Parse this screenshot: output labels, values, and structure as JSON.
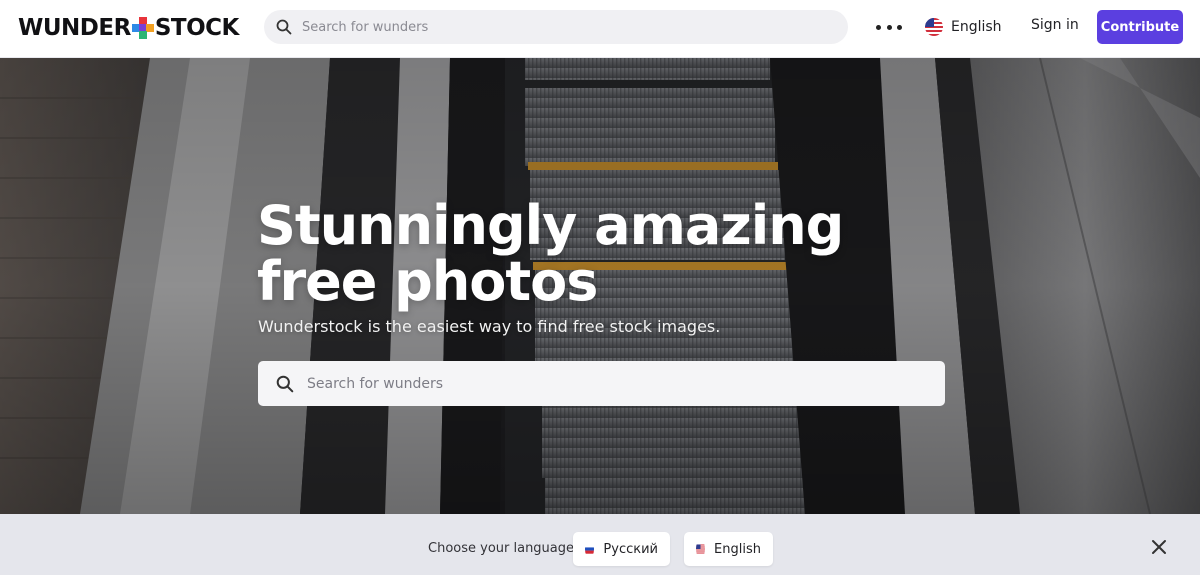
{
  "header": {
    "logo_left": "WUNDER",
    "logo_right": "STOCK",
    "search_placeholder": "Search for wunders",
    "more_icon": "more-horizontal-icon",
    "language_label": "English",
    "signin_label": "Sign in",
    "contribute_label": "Contribute"
  },
  "hero": {
    "title_line1": "Stunningly amazing",
    "title_line2": "free photos",
    "subtitle": "Wunderstock is the easiest way to find free stock images.",
    "search_placeholder": "Search for wunders"
  },
  "language_bar": {
    "label": "Choose your language",
    "options": [
      {
        "label": "Русский",
        "flag": "ru-flag-icon"
      },
      {
        "label": "English",
        "flag": "us-flag-icon"
      }
    ],
    "close_icon": "close-icon"
  },
  "colors": {
    "accent": "#5b3fe0",
    "logo_red": "#e8343b",
    "logo_blue": "#2d8ae6",
    "logo_purple": "#7a3fd6",
    "logo_green": "#2bb673",
    "language_bar_bg": "#e5e6ec"
  }
}
